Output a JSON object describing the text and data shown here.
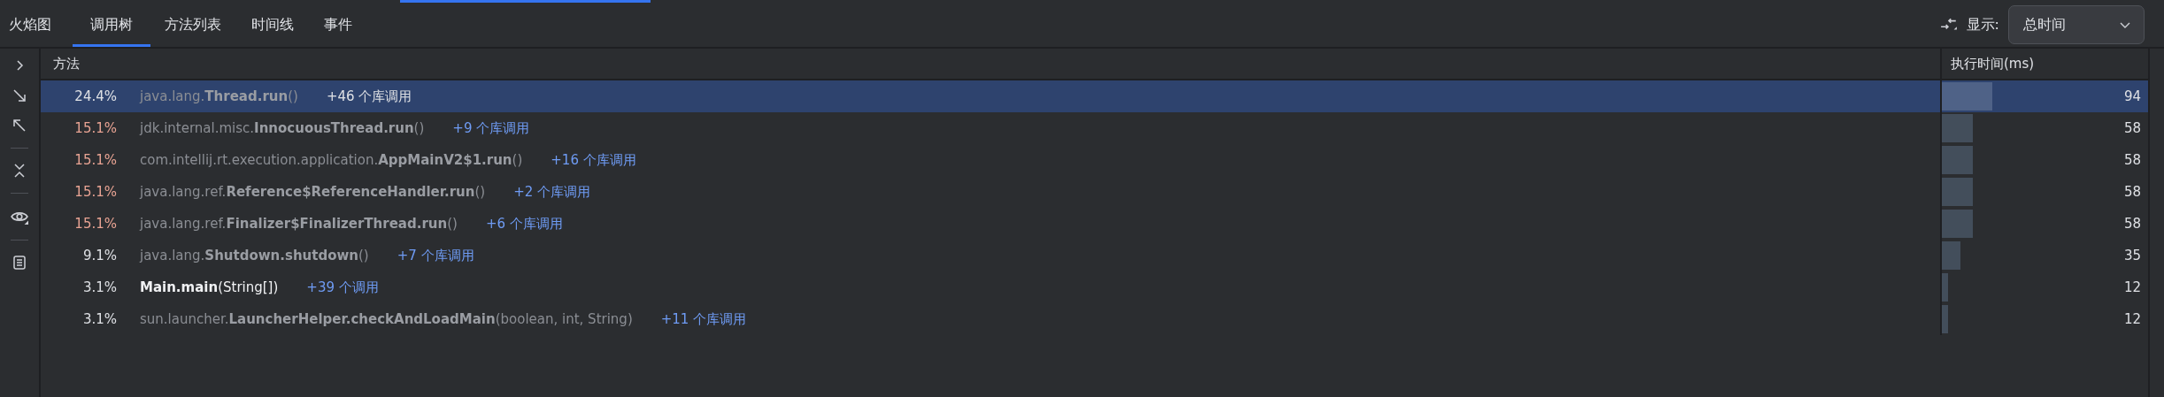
{
  "tabs": [
    {
      "label": "火焰图",
      "selected": false
    },
    {
      "label": "调用树",
      "selected": true
    },
    {
      "label": "方法列表",
      "selected": false
    },
    {
      "label": "时间线",
      "selected": false
    },
    {
      "label": "事件",
      "selected": false
    }
  ],
  "display": {
    "label": "显示:",
    "value": "总时间"
  },
  "table": {
    "columns": [
      "方法",
      "执行时间(ms)"
    ],
    "rows": [
      {
        "percent": "24.4%",
        "hot": false,
        "signature": "java.lang.**Thread.run**()",
        "project": false,
        "calls": "+46 个库调用",
        "time": "94",
        "level": 0.244,
        "selected": true
      },
      {
        "percent": "15.1%",
        "hot": true,
        "signature": "jdk.internal.misc.**InnocuousThread.run**()",
        "project": false,
        "calls": "+9 个库调用",
        "time": "58",
        "level": 0.151,
        "selected": false
      },
      {
        "percent": "15.1%",
        "hot": true,
        "signature": "com.intellij.rt.execution.application.**AppMainV2$1.run**()",
        "project": false,
        "calls": "+16 个库调用",
        "time": "58",
        "level": 0.151,
        "selected": false
      },
      {
        "percent": "15.1%",
        "hot": true,
        "signature": "java.lang.ref.**Reference$ReferenceHandler.run**()",
        "project": false,
        "calls": "+2 个库调用",
        "time": "58",
        "level": 0.151,
        "selected": false
      },
      {
        "percent": "15.1%",
        "hot": true,
        "signature": "java.lang.ref.**Finalizer$FinalizerThread.run**()",
        "project": false,
        "calls": "+6 个库调用",
        "time": "58",
        "level": 0.151,
        "selected": false
      },
      {
        "percent": "9.1%",
        "hot": false,
        "signature": "java.lang.**Shutdown.shutdown**()",
        "project": false,
        "calls": "+7 个库调用",
        "time": "35",
        "level": 0.091,
        "selected": false
      },
      {
        "percent": "3.1%",
        "hot": false,
        "signature": "**Main.main**(String[])",
        "project": true,
        "calls": "+39 个调用",
        "time": "12",
        "level": 0.031,
        "selected": false
      },
      {
        "percent": "3.1%",
        "hot": false,
        "signature": "sun.launcher.**LauncherHelper.checkAndLoadMain**(boolean, int, String)",
        "project": false,
        "calls": "+11 个库调用",
        "time": "12",
        "level": 0.031,
        "selected": false
      }
    ]
  }
}
